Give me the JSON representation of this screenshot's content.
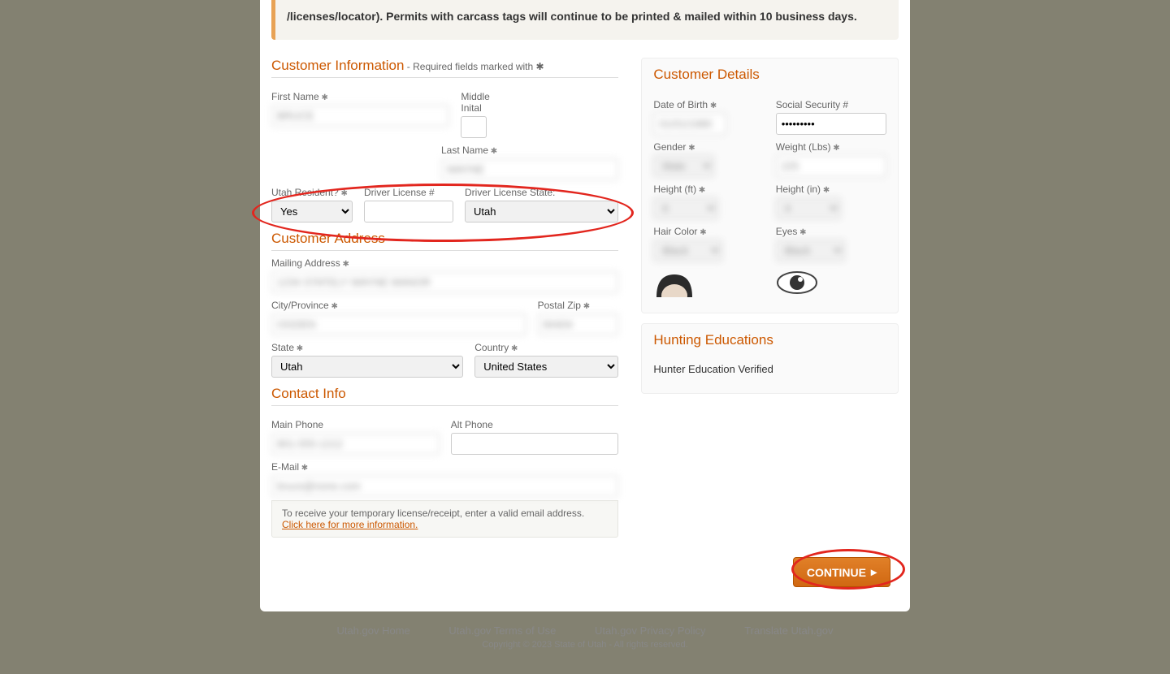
{
  "notice_text": "/licenses/locator). Permits with carcass tags will continue to be printed & mailed within 10 business days.",
  "sections": {
    "customer_info": {
      "heading": "Customer Information",
      "sub": " - Required fields marked with ✱"
    },
    "customer_address": {
      "heading": "Customer Address"
    },
    "contact_info": {
      "heading": "Contact Info"
    },
    "customer_details": {
      "heading": "Customer Details"
    },
    "hunting_ed": {
      "heading": "Hunting Educations",
      "status": "Hunter Education Verified"
    }
  },
  "labels": {
    "first_name": "First Name",
    "middle_initial": "Middle Inital",
    "last_name": "Last Name",
    "utah_resident": "Utah Resident?",
    "dl_number": "Driver License #",
    "dl_state": "Driver License State:",
    "mailing_address": "Mailing Address",
    "city": "City/Province",
    "postal": "Postal Zip",
    "state": "State",
    "country": "Country",
    "main_phone": "Main Phone",
    "alt_phone": "Alt Phone",
    "email": "E-Mail",
    "dob": "Date of Birth",
    "ssn": "Social Security #",
    "gender": "Gender",
    "weight": "Weight (Lbs)",
    "height_ft": "Height (ft)",
    "height_in": "Height (in)",
    "hair": "Hair Color",
    "eyes": "Eyes"
  },
  "values": {
    "first_name": "BRUCE",
    "middle_initial": "",
    "last_name": "WAYNE",
    "utah_resident": "Yes",
    "dl_number": "",
    "dl_state": "Utah",
    "mailing_address": "1234 STATELY WAYNE MANOR",
    "city": "OGDEN",
    "postal": "84404",
    "state": "Utah",
    "country": "United States",
    "main_phone": "801-555-1212",
    "alt_phone": "",
    "email": "bruce@none.com",
    "dob": "01/01/1980",
    "ssn": "•••••••••",
    "gender": "Male",
    "weight": "225",
    "height_ft": "6",
    "height_in": "4",
    "hair": "Black",
    "eyes": "Black"
  },
  "email_note": {
    "text": "To receive your temporary license/receipt, enter a valid email address.",
    "link": "Click here for more information."
  },
  "continue_label": "CONTINUE",
  "footer": {
    "links": [
      "Utah.gov Home",
      "Utah.gov Terms of Use",
      "Utah.gov Privacy Policy",
      "Translate Utah.gov"
    ],
    "copyright": "Copyright © 2023 State of Utah - All rights reserved."
  }
}
